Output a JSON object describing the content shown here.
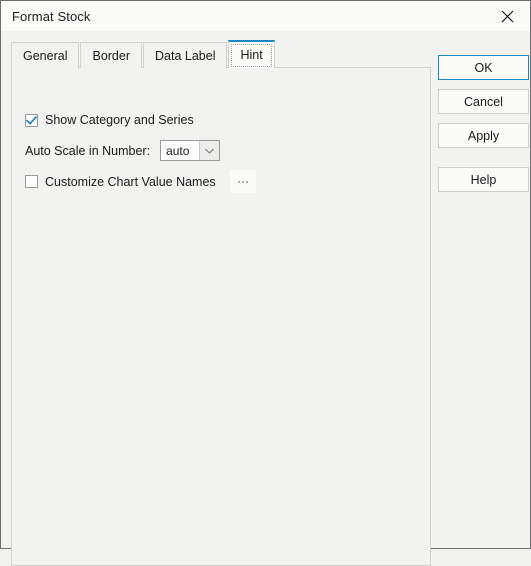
{
  "window": {
    "title": "Format Stock",
    "close_icon": "close-icon"
  },
  "tabs": [
    {
      "label": "General",
      "selected": false
    },
    {
      "label": "Border",
      "selected": false
    },
    {
      "label": "Data Label",
      "selected": false
    },
    {
      "label": "Hint",
      "selected": true
    }
  ],
  "panel": {
    "show_category_and_series": {
      "label": "Show Category and Series",
      "checked": true
    },
    "auto_scale": {
      "label": "Auto Scale in Number:",
      "value": "auto",
      "options": [
        "auto"
      ],
      "arrow_icon": "chevron-down-icon"
    },
    "customize_chart_value_names": {
      "label": "Customize Chart Value Names",
      "checked": false,
      "browse_label": "..."
    }
  },
  "buttons": {
    "ok": "OK",
    "cancel": "Cancel",
    "apply": "Apply",
    "help": "Help"
  },
  "colors": {
    "accent": "#1a87c9",
    "dialog_bg": "#f2f3f1",
    "titlebar_bg": "#fbfcfa",
    "border": "#d2d3d1",
    "window_border": "#6d6d6d",
    "check_blue": "#1a87c9"
  }
}
